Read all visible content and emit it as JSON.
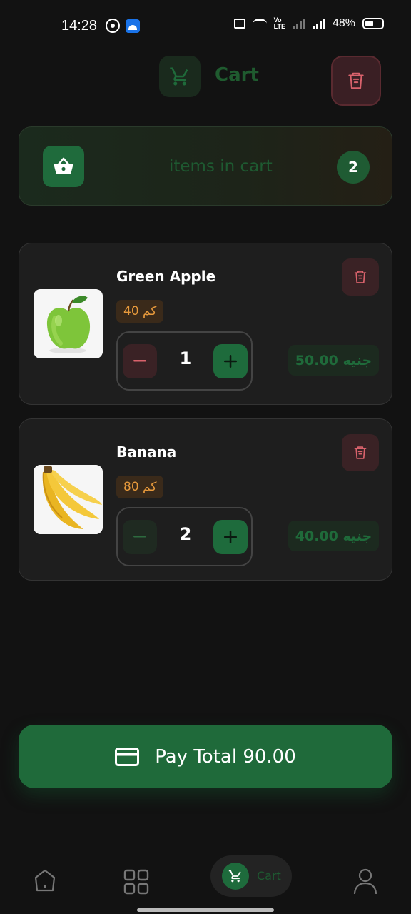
{
  "status_bar": {
    "time": "14:28",
    "battery": "48%"
  },
  "header": {
    "title": "Cart",
    "cart_icon": "cart-icon",
    "clear_icon": "trash-icon"
  },
  "summary": {
    "label": "items in cart",
    "count": "2",
    "icon": "basket-icon"
  },
  "items": [
    {
      "name": "Green Apple",
      "weight": "40 كم",
      "quantity": "1",
      "price": "50.00 جنيه",
      "image": "green-apple"
    },
    {
      "name": "Banana",
      "weight": "80 كم",
      "quantity": "2",
      "price": "40.00 جنيه",
      "image": "banana"
    }
  ],
  "pay": {
    "label": "Pay Total 90.00",
    "icon": "credit-card-icon"
  },
  "nav": {
    "cart_label": "Cart",
    "items": [
      "home-icon",
      "grid-icon",
      "cart-icon",
      "profile-icon"
    ]
  },
  "colors": {
    "accent": "#1f6a3a",
    "danger": "#d9626c",
    "weight_text": "#e89a3c",
    "background": "#121212"
  }
}
